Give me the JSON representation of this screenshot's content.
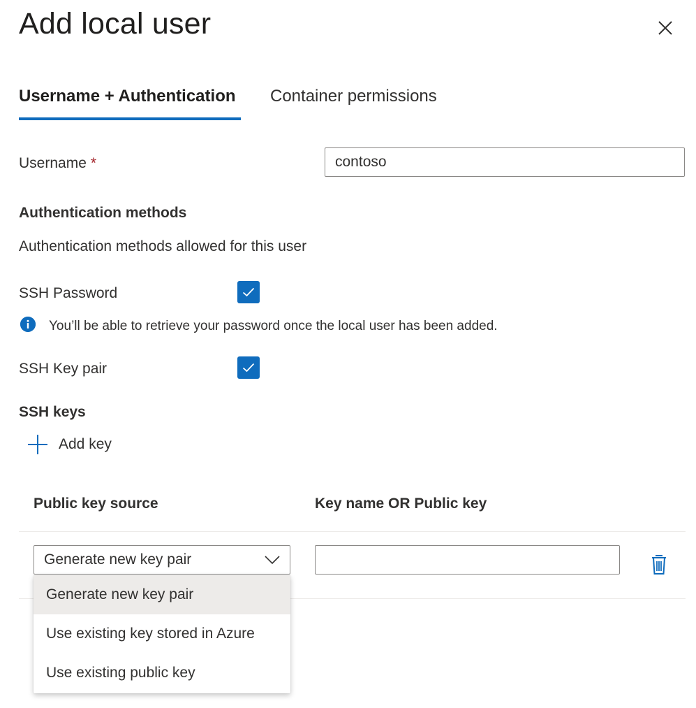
{
  "panel": {
    "title": "Add local user",
    "close_icon": "close-icon"
  },
  "tabs": [
    {
      "label": "Username + Authentication",
      "active": true
    },
    {
      "label": "Container permissions",
      "active": false
    }
  ],
  "username": {
    "label": "Username",
    "required_marker": "*",
    "value": "contoso"
  },
  "auth": {
    "heading": "Authentication methods",
    "description": "Authentication methods allowed for this user",
    "ssh_password": {
      "label": "SSH Password",
      "checked": true
    },
    "info_text": "You’ll be able to retrieve your password once the local user has been added.",
    "ssh_key_pair": {
      "label": "SSH Key pair",
      "checked": true
    }
  },
  "ssh_keys": {
    "heading": "SSH keys",
    "add_key_label": "Add key",
    "columns": [
      "Public key source",
      "Key name OR Public key"
    ],
    "rows": [
      {
        "source": "Generate new key pair",
        "key_value": ""
      }
    ],
    "source_options": [
      "Generate new key pair",
      "Use existing key stored in Azure",
      "Use existing public key"
    ],
    "selected_option_index": 0
  },
  "colors": {
    "accent": "#0f6cbd",
    "required": "#a4262c",
    "text": "#323130"
  }
}
